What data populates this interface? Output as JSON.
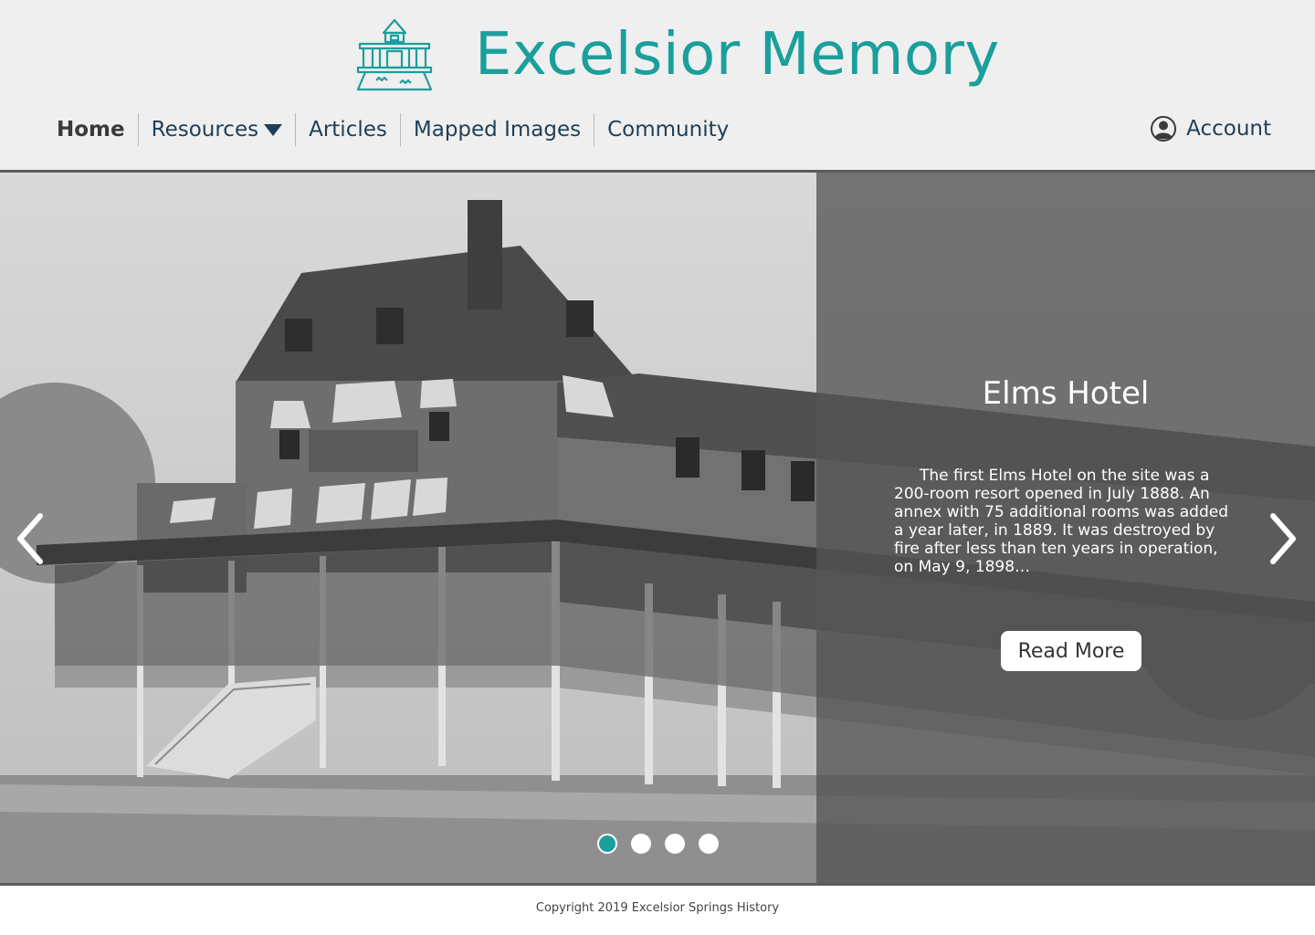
{
  "brand": {
    "title": "Excelsior Memory",
    "color": "#1a9f9c"
  },
  "nav": {
    "items": [
      {
        "label": "Home",
        "active": true
      },
      {
        "label": "Resources",
        "has_dropdown": true
      },
      {
        "label": "Articles"
      },
      {
        "label": "Mapped Images"
      },
      {
        "label": "Community"
      }
    ]
  },
  "account": {
    "label": "Account",
    "icon": "user-circle-icon"
  },
  "slide": {
    "title": "Elms Hotel",
    "description": "The first Elms Hotel on the site was a 200-room resort opened in July 1888. An annex with 75 additional rooms was added a year later, in 1889. It was destroyed by fire after less than ten years in operation, on May 9, 1898…",
    "button_label": "Read More",
    "current_index": 0,
    "total": 4,
    "prev_icon": "chevron-left-icon",
    "next_icon": "chevron-right-icon"
  },
  "footer": {
    "copyright": "Copyright 2019 Excelsior Springs History"
  },
  "colors": {
    "accent": "#1a9f9c",
    "nav_text": "#1e3f57",
    "header_bg": "#efefef"
  }
}
